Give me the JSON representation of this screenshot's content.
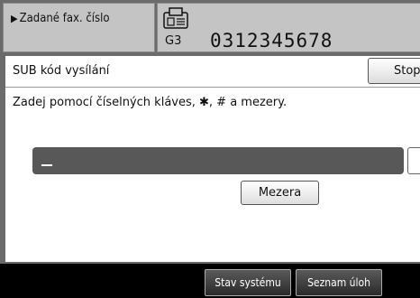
{
  "destination": {
    "label": "Zadané fax. číslo",
    "arrow": "▶"
  },
  "fax": {
    "line_type": "G3",
    "number": "0312345678",
    "icon": "fax-icon"
  },
  "panel": {
    "title": "SUB kód vysílání",
    "stop_label": "Stop",
    "instruction": "Zadej pomocí číselných kláves, ✱, # a mezery.",
    "input_value": "",
    "space_label": "Mezera"
  },
  "status_bar": {
    "system_status_label": "Stav systému",
    "job_list_label": "Seznam úloh"
  }
}
